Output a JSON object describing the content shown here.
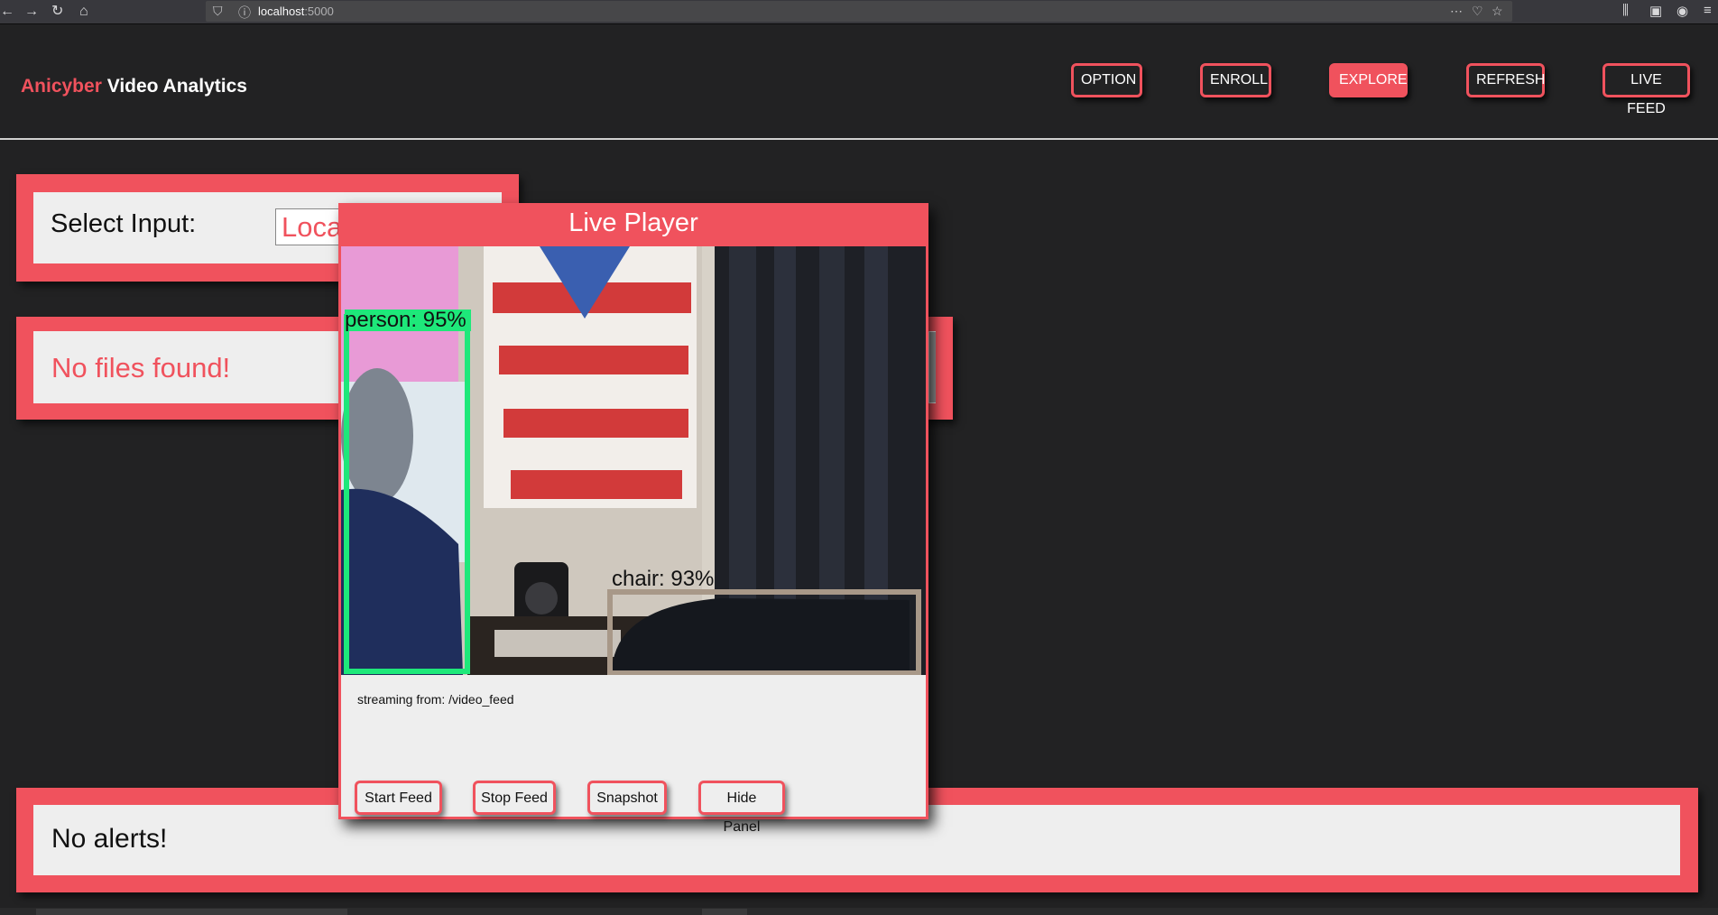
{
  "browser": {
    "url_host": "localhost",
    "url_port": ":5000",
    "icons": [
      "back-arrow-icon",
      "forward-arrow-icon",
      "reload-icon",
      "home-icon",
      "shield-icon",
      "info-icon",
      "more-icon",
      "pocket-icon",
      "star-icon",
      "library-icon",
      "sidebar-icon",
      "account-icon",
      "menu-icon"
    ]
  },
  "header": {
    "brand_accent": "Anicyber",
    "brand_rest": " Video Analytics",
    "nav": [
      "OPTION",
      "ENROLL",
      "EXPLORE",
      "REFRESH",
      "LIVE FEED"
    ],
    "active_nav": "EXPLORE"
  },
  "input_panel": {
    "label": "Select Input:",
    "value": "Local"
  },
  "files_panel": {
    "message": "No files found!"
  },
  "alerts_panel": {
    "message": "No alerts!"
  },
  "player": {
    "title": "Live Player",
    "detections": [
      {
        "label": "person: 95%",
        "color": "#1ee87a"
      },
      {
        "label": "chair: 93%",
        "color": "#a89888"
      }
    ],
    "stream_label": "streaming from: /video_feed",
    "buttons": [
      "Start Feed",
      "Stop Feed",
      "Snapshot",
      "Hide Panel"
    ]
  },
  "colors": {
    "accent": "#f0525d",
    "background": "#222223",
    "panel": "#eeeeee"
  }
}
